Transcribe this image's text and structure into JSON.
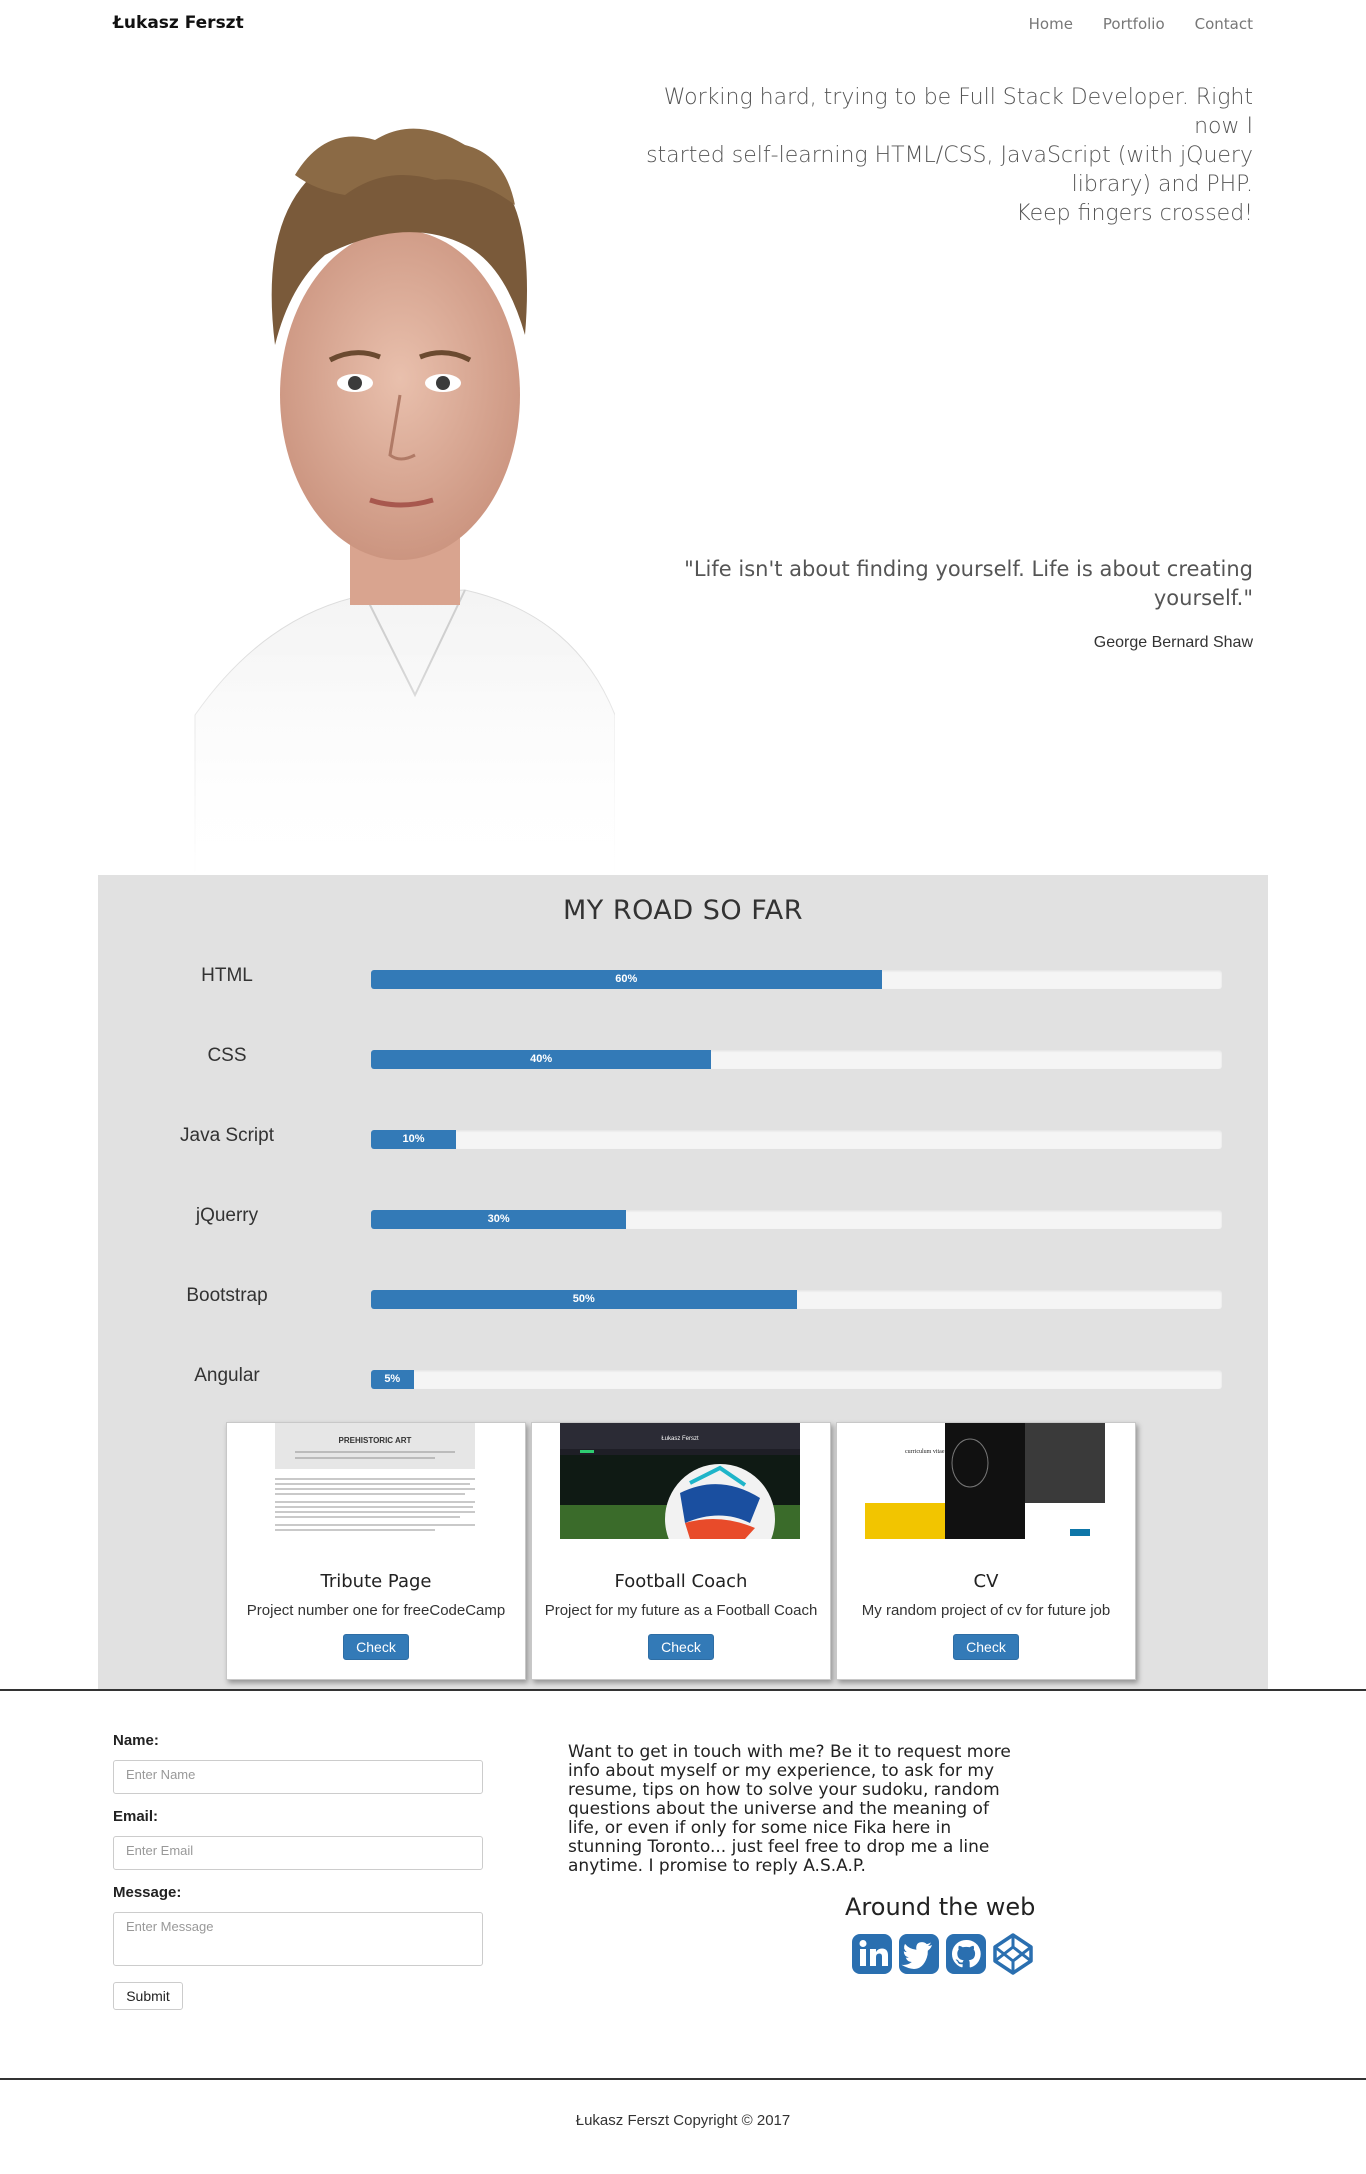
{
  "nav": {
    "brand": "Łukasz Ferszt",
    "links": [
      "Home",
      "Portfolio",
      "Contact"
    ]
  },
  "hero": {
    "intro_lines": [
      "Working hard, trying to be Full Stack Developer. Right now I",
      "started self-learning HTML/CSS, JavaScript (with jQuery",
      "library) and PHP.",
      "Keep fingers crossed!"
    ],
    "quote_lines": [
      "\"Life isn't about finding yourself. Life is about creating",
      "yourself.\""
    ],
    "quote_author": "George Bernard Shaw"
  },
  "skills": {
    "title": "MY ROAD SO FAR",
    "items": [
      {
        "name": "HTML",
        "percent": 60,
        "label": "60%"
      },
      {
        "name": "CSS",
        "percent": 40,
        "label": "40%"
      },
      {
        "name": "Java Script",
        "percent": 10,
        "label": "10%"
      },
      {
        "name": "jQuerry",
        "percent": 30,
        "label": "30%"
      },
      {
        "name": "Bootstrap",
        "percent": 50,
        "label": "50%"
      },
      {
        "name": "Angular",
        "percent": 5,
        "label": "5%"
      }
    ],
    "bar_color": "#337ab7"
  },
  "projects": [
    {
      "title": "Tribute Page",
      "description": "Project number one for freeCodeCamp",
      "button": "Check",
      "thumb_title": "PREHISTORIC ART"
    },
    {
      "title": "Football Coach",
      "description": "Project for my future as a Football Coach",
      "button": "Check",
      "thumb_title": "Łukasz Ferszt"
    },
    {
      "title": "CV",
      "description": "My random project of cv for future job",
      "button": "Check",
      "thumb_title": "curriculum vitae"
    }
  ],
  "contact": {
    "name_label": "Name:",
    "name_placeholder": "Enter Name",
    "email_label": "Email:",
    "email_placeholder": "Enter Email",
    "message_label": "Message:",
    "message_placeholder": "Enter Message",
    "submit": "Submit",
    "text_lines": [
      "Want to get in touch with me? Be it to request more",
      "info about myself or my experience, to ask for my",
      "resume, tips on how to solve your sudoku, random",
      "questions about the universe and the meaning of",
      "life, or even if only for some nice Fika here in",
      "stunning Toronto... just feel free to drop me a line",
      "anytime. I promise to reply A.S.A.P."
    ],
    "web_title": "Around the web",
    "social_icons": [
      "linkedin-icon",
      "twitter-icon",
      "github-icon",
      "codepen-icon"
    ],
    "social_color": "#2a6fb0"
  },
  "footer": {
    "text": "Łukasz Ferszt Copyright © 2017"
  }
}
